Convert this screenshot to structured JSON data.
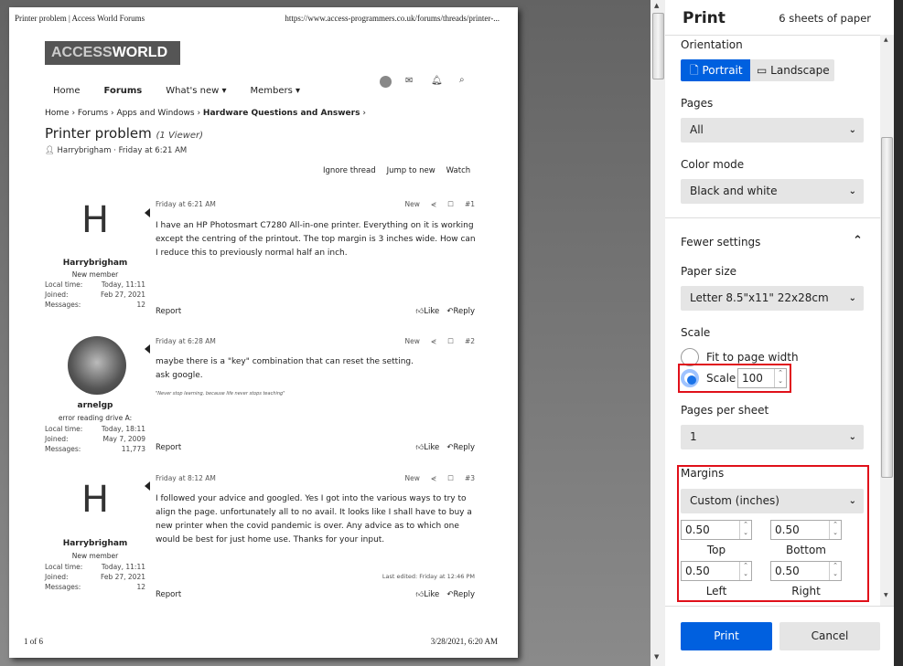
{
  "preview": {
    "header_title": "Printer problem | Access World Forums",
    "header_url": "https://www.access-programmers.co.uk/forums/threads/printer-...",
    "logo_part1": "ACCESS",
    "logo_part2": "WORLD",
    "nav": [
      "Home",
      "Forums",
      "What's new ▾",
      "Members ▾"
    ],
    "breadcrumb": [
      "Home",
      "Forums",
      "Apps and Windows",
      "Hardware Questions and Answers"
    ],
    "thread_title": "Printer problem",
    "viewers": "(1 Viewer)",
    "thread_meta": "Harrybrigham · Friday at 6:21 AM",
    "thread_buttons": [
      "Ignore thread",
      "Jump to new",
      "Watch"
    ],
    "labels": {
      "local_time": "Local time:",
      "joined": "Joined:",
      "messages": "Messages:",
      "new": "New",
      "report": "Report",
      "like": "Like",
      "reply": "Reply"
    },
    "posts": [
      {
        "avatar_letter": "H",
        "user": "Harrybrigham",
        "role": "New member",
        "local_time": "Today, 11:11",
        "joined": "Feb 27, 2021",
        "messages": "12",
        "date": "Friday at 6:21 AM",
        "num": "#1",
        "body": "I have an HP Photosmart C7280 All-in-one printer. Everything on it is working except the centring of the printout. The top margin is 3 inches wide. How can I reduce this to previously normal half an inch."
      },
      {
        "user": "arnelgp",
        "role": "error reading drive A:",
        "local_time": "Today, 18:11",
        "joined": "May 7, 2009",
        "messages": "11,773",
        "date": "Friday at 6:28 AM",
        "num": "#2",
        "body": "maybe there is a \"key\" combination that can reset the setting.\nask google.",
        "signature": "\"Never stop learning, because life never stops teaching\""
      },
      {
        "avatar_letter": "H",
        "user": "Harrybrigham",
        "role": "New member",
        "local_time": "Today, 11:11",
        "joined": "Feb 27, 2021",
        "messages": "12",
        "date": "Friday at 8:12 AM",
        "num": "#3",
        "body": "I followed your advice and googled. Yes I got into the various ways to try to align the page. unfortunately all to no avail. It looks like I shall have to buy a new printer when the covid pandemic is over. Any advice as to which one would be best for just home use. Thanks for your input.",
        "last_edited": "Last edited: Friday at 12:46 PM"
      }
    ],
    "footer_page": "1 of 6",
    "footer_date": "3/28/2021, 6:20 AM"
  },
  "panel": {
    "title": "Print",
    "sheets": "6 sheets of paper",
    "orientation_label": "Orientation",
    "portrait": "Portrait",
    "landscape": "Landscape",
    "pages_label": "Pages",
    "pages_value": "All",
    "color_label": "Color mode",
    "color_value": "Black and white",
    "fewer_settings": "Fewer settings",
    "paper_label": "Paper size",
    "paper_value": "Letter 8.5\"x11\" 22x28cm",
    "scale_label": "Scale",
    "fit_label": "Fit to page width",
    "scale_radio_label": "Scale",
    "scale_value": "100",
    "pps_label": "Pages per sheet",
    "pps_value": "1",
    "margins_label": "Margins",
    "margins_value": "Custom (inches)",
    "top_value": "0.50",
    "bottom_value": "0.50",
    "left_value": "0.50",
    "right_value": "0.50",
    "top_label": "Top",
    "bottom_label": "Bottom",
    "left_label": "Left",
    "right_label": "Right",
    "print_btn": "Print",
    "cancel_btn": "Cancel",
    "accent": "#0060df",
    "highlight": "#e0101a"
  }
}
